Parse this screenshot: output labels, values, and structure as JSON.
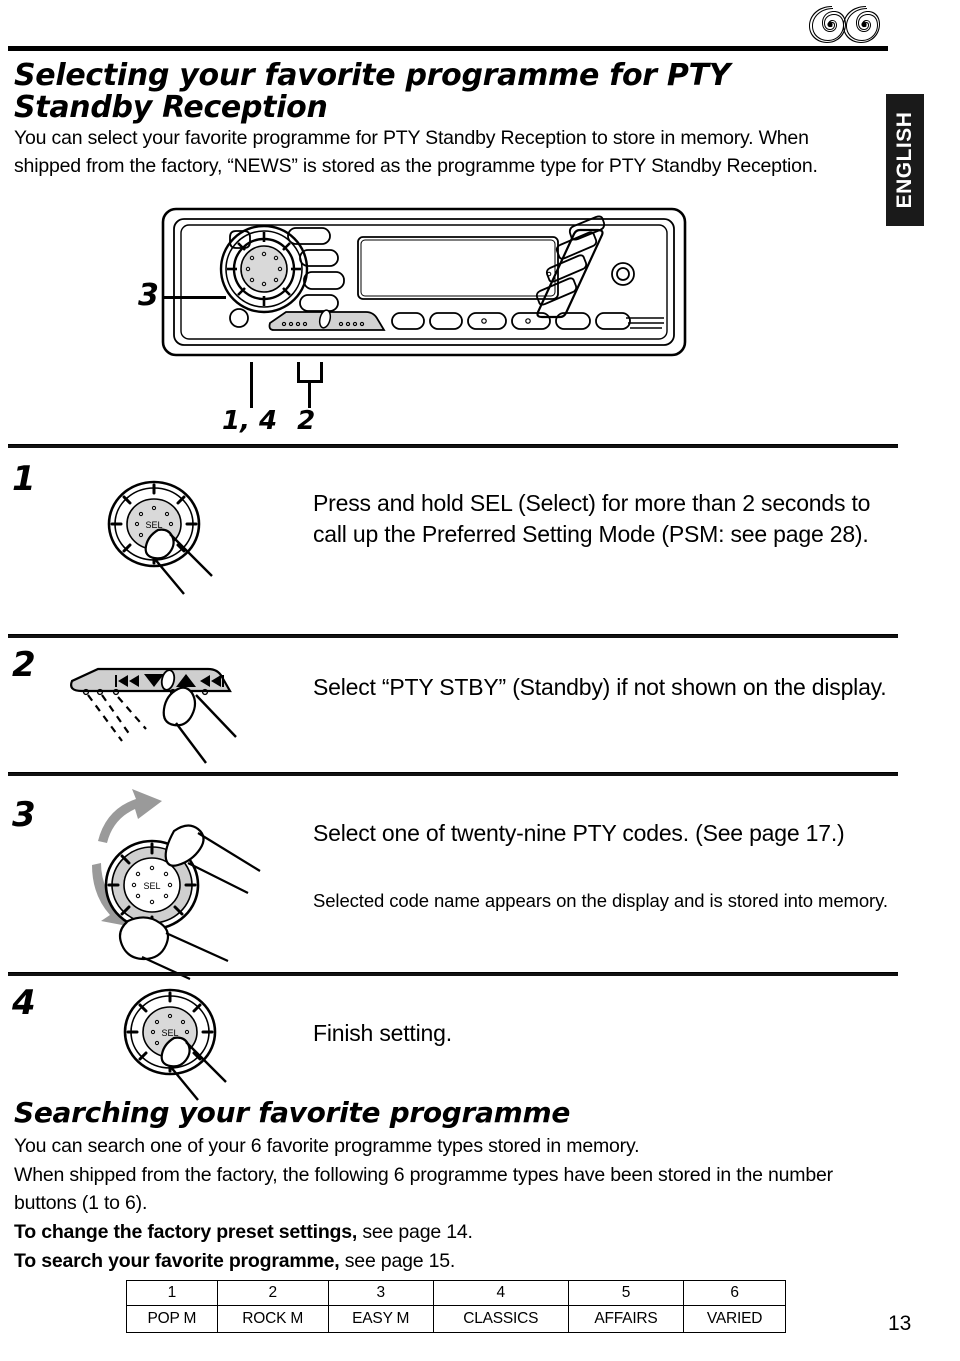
{
  "header": {
    "logo_icon": "cd-double-spiral-logo",
    "language_tab": "ENGLISH"
  },
  "title": "Selecting your favorite programme for PTY Standby Reception",
  "intro": "You can select your favorite programme for PTY Standby Reception to store in memory. When shipped from the factory, “NEWS” is stored as the programme type for PTY Standby Reception.",
  "figure": {
    "callout_knob": "3",
    "callout_sel": "1, 4",
    "callout_updown": "2",
    "knob_label": "SEL"
  },
  "steps": [
    {
      "number": "1",
      "icon": "sel-knob-press-icon",
      "text": "Press and hold SEL (Select) for more than 2 seconds to call up the Preferred Setting Mode (PSM: see page 28).",
      "sub": ""
    },
    {
      "number": "2",
      "icon": "up-down-buttons-icon",
      "text": "Select “PTY STBY” (Standby) if not shown on the display.",
      "sub": ""
    },
    {
      "number": "3",
      "icon": "sel-knob-rotate-icon",
      "text": "Select one of twenty-nine PTY codes. (See page 17.)",
      "sub": "Selected code name appears on the display and is stored into memory."
    },
    {
      "number": "4",
      "icon": "sel-knob-press-icon",
      "text": "Finish setting.",
      "sub": ""
    }
  ],
  "section": {
    "title": "Searching your favorite programme",
    "line1": "You can search one of your 6 favorite programme types stored in memory.",
    "line2": "When shipped from the factory, the following 6 programme types have been stored in the number buttons (1 to 6).",
    "line3_bold": "To change the factory preset settings,",
    "line3_rest": " see page 14.",
    "line4_bold": "To search your favorite programme,",
    "line4_rest": " see page 15."
  },
  "preset_table": {
    "numbers": [
      "1",
      "2",
      "3",
      "4",
      "5",
      "6"
    ],
    "types": [
      "POP M",
      "ROCK M",
      "EASY M",
      "CLASSICS",
      "AFFAIRS",
      "VARIED"
    ]
  },
  "page_number": "13"
}
